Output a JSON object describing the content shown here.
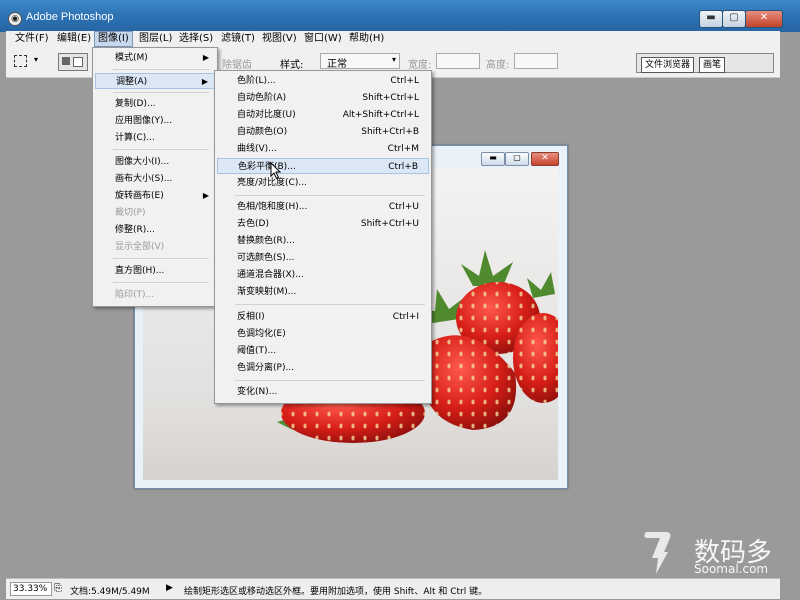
{
  "app": {
    "title": "Adobe Photoshop"
  },
  "window_controls": {
    "minimize": "▬",
    "maximize": "▢",
    "close": "✕"
  },
  "menubar": [
    {
      "label": "文件(F)"
    },
    {
      "label": "编辑(E)"
    },
    {
      "label": "图像(I)"
    },
    {
      "label": "图层(L)"
    },
    {
      "label": "选择(S)"
    },
    {
      "label": "滤镜(T)"
    },
    {
      "label": "视图(V)"
    },
    {
      "label": "窗口(W)"
    },
    {
      "label": "帮助(H)"
    }
  ],
  "options_bar": {
    "partial_label": "除锯齿",
    "style_label": "样式:",
    "style_value": "正常",
    "width_label": "宽度:",
    "height_label": "高度:"
  },
  "palette_tabs": [
    {
      "label": "文件浏览器"
    },
    {
      "label": "画笔"
    }
  ],
  "image_menu": {
    "items": [
      {
        "label": "模式(M)",
        "submenu": true
      },
      {
        "label": "调整(A)",
        "submenu": true,
        "highlighted": true
      },
      {
        "label": "复制(D)..."
      },
      {
        "label": "应用图像(Y)..."
      },
      {
        "label": "计算(C)..."
      },
      {
        "label": "图像大小(I)..."
      },
      {
        "label": "画布大小(S)..."
      },
      {
        "label": "旋转画布(E)",
        "submenu": true
      },
      {
        "label": "裁切(P)",
        "disabled": true
      },
      {
        "label": "修整(R)..."
      },
      {
        "label": "显示全部(V)",
        "disabled": true
      },
      {
        "label": "直方图(H)..."
      },
      {
        "label": "陷印(T)...",
        "disabled": true
      }
    ]
  },
  "adjust_menu": {
    "items": [
      {
        "label": "色阶(L)...",
        "shortcut": "Ctrl+L"
      },
      {
        "label": "自动色阶(A)",
        "shortcut": "Shift+Ctrl+L"
      },
      {
        "label": "自动对比度(U)",
        "shortcut": "Alt+Shift+Ctrl+L"
      },
      {
        "label": "自动颜色(O)",
        "shortcut": "Shift+Ctrl+B"
      },
      {
        "label": "曲线(V)...",
        "shortcut": "Ctrl+M"
      },
      {
        "label": "色彩平衡(B)...",
        "shortcut": "Ctrl+B",
        "highlighted": true
      },
      {
        "label": "亮度/对比度(C)...",
        "shortcut": ""
      },
      {
        "label": "色相/饱和度(H)...",
        "shortcut": "Ctrl+U"
      },
      {
        "label": "去色(D)",
        "shortcut": "Shift+Ctrl+U"
      },
      {
        "label": "替换颜色(R)...",
        "shortcut": ""
      },
      {
        "label": "可选颜色(S)...",
        "shortcut": ""
      },
      {
        "label": "通道混合器(X)...",
        "shortcut": ""
      },
      {
        "label": "渐变映射(M)...",
        "shortcut": ""
      },
      {
        "label": "反相(I)",
        "shortcut": "Ctrl+I"
      },
      {
        "label": "色调均化(E)",
        "shortcut": ""
      },
      {
        "label": "阈值(T)...",
        "shortcut": ""
      },
      {
        "label": "色调分离(P)...",
        "shortcut": ""
      },
      {
        "label": "变化(N)...",
        "shortcut": ""
      }
    ]
  },
  "statusbar": {
    "zoom": "33.33%",
    "doc_info": "文档:5.49M/5.49M",
    "hint": "绘制矩形选区或移动选区外框。要用附加选项，使用 Shift、Alt 和 Ctrl 键。"
  },
  "watermark": {
    "cn": "数码多",
    "en": "Soomal.com"
  },
  "colors": {
    "titlebar": "#2a6fb0",
    "workspace": "#9a9a9a",
    "highlight": "#dbe7f5",
    "strawberry": "#d9201b"
  }
}
